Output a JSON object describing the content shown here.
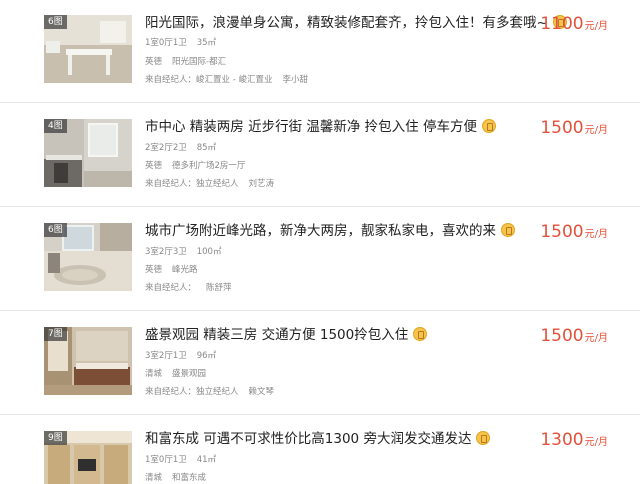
{
  "listings": [
    {
      "photo_count": "6图",
      "title": "阳光国际，浪漫单身公寓，精致装修配套齐，拎包入住！有多套哦~",
      "layout": "1室0厅1卫",
      "area": "35㎡",
      "district": "英德",
      "community": "阳光国际-都汇",
      "agent_label": "来自经纪人：峻汇置业 - 峻汇置业",
      "agent_name": "李小甜",
      "price": "1100",
      "price_unit": "元/月",
      "badge_icon": "verified-badge-icon"
    },
    {
      "photo_count": "4图",
      "title": "市中心 精装两房 近步行街 温馨新净 拎包入住 停车方便",
      "layout": "2室2厅2卫",
      "area": "85㎡",
      "district": "英德",
      "community": "德多利广场2房一厅",
      "agent_label": "来自经纪人：独立经纪人",
      "agent_name": "刘艺涛",
      "price": "1500",
      "price_unit": "元/月",
      "badge_icon": "verified-badge-icon"
    },
    {
      "photo_count": "6图",
      "title": "城市广场附近峰光路，新净大两房，靓家私家电，喜欢的来",
      "layout": "3室2厅3卫",
      "area": "100㎡",
      "district": "英德",
      "community": "峰光路",
      "agent_label": "来自经纪人：",
      "agent_name": "陈舒萍",
      "price": "1500",
      "price_unit": "元/月",
      "badge_icon": "verified-badge-icon"
    },
    {
      "photo_count": "7图",
      "title": "盛景观园 精装三房 交通方便 1500拎包入住",
      "layout": "3室2厅1卫",
      "area": "96㎡",
      "district": "清城",
      "community": "盛景观园",
      "agent_label": "来自经纪人：独立经纪人",
      "agent_name": "赖文琴",
      "price": "1500",
      "price_unit": "元/月",
      "badge_icon": "verified-badge-icon"
    },
    {
      "photo_count": "9图",
      "title": "和富东成 可遇不可求性价比高1300 旁大润发交通发达",
      "layout": "1室0厅1卫",
      "area": "41㎡",
      "district": "清城",
      "community": "和富东成",
      "agent_label": "",
      "agent_name": "",
      "price": "1300",
      "price_unit": "元/月",
      "badge_icon": "verified-badge-icon"
    }
  ],
  "colors": {
    "price": "#e4513a",
    "title": "#222222",
    "meta": "#888888",
    "badge": "#f6c44a"
  }
}
